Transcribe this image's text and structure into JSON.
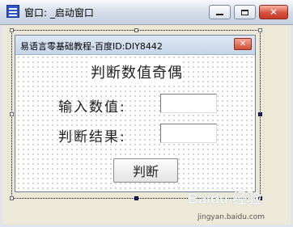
{
  "outer_window": {
    "title": "窗口: _启动窗口"
  },
  "form_window": {
    "title": "易语言零基础教程-百度ID:DIY8442"
  },
  "form": {
    "heading": "判断数值奇偶",
    "input_label": "输入数值:",
    "input_value": "",
    "result_label": "判断结果:",
    "result_value": "",
    "judge_button": "判断"
  },
  "watermark": {
    "main": "Baidu 经验",
    "sub": "jingyan.baidu.com"
  }
}
